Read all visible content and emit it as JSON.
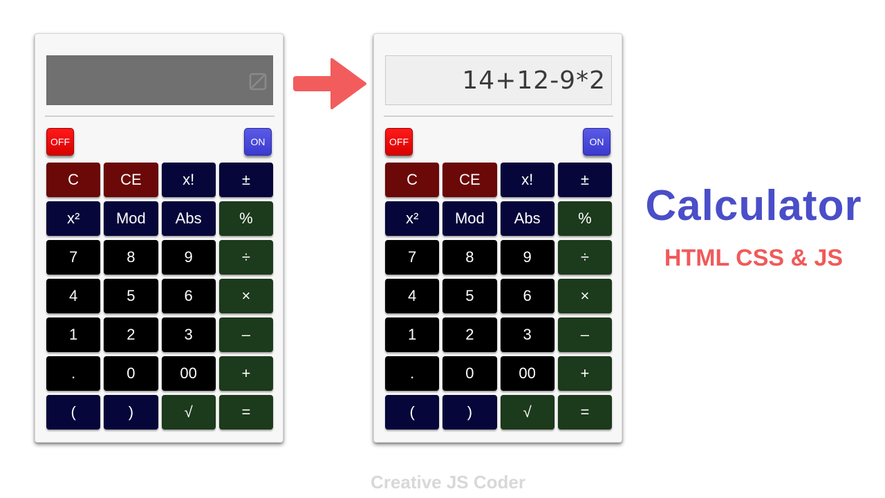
{
  "left_calculator": {
    "screen_state": "off",
    "display_icon": "screen-off-icon",
    "off_label": "OFF",
    "on_label": "ON",
    "keys": [
      {
        "label": "C",
        "color": "red"
      },
      {
        "label": "CE",
        "color": "red"
      },
      {
        "label": "x!",
        "color": "navy"
      },
      {
        "label": "±",
        "color": "navy"
      },
      {
        "label": "x²",
        "color": "navy"
      },
      {
        "label": "Mod",
        "color": "navy"
      },
      {
        "label": "Abs",
        "color": "navy"
      },
      {
        "label": "%",
        "color": "green"
      },
      {
        "label": "7",
        "color": "black"
      },
      {
        "label": "8",
        "color": "black"
      },
      {
        "label": "9",
        "color": "black"
      },
      {
        "label": "÷",
        "color": "green"
      },
      {
        "label": "4",
        "color": "black"
      },
      {
        "label": "5",
        "color": "black"
      },
      {
        "label": "6",
        "color": "black"
      },
      {
        "label": "×",
        "color": "green"
      },
      {
        "label": "1",
        "color": "black"
      },
      {
        "label": "2",
        "color": "black"
      },
      {
        "label": "3",
        "color": "black"
      },
      {
        "label": "–",
        "color": "green"
      },
      {
        "label": ".",
        "color": "black"
      },
      {
        "label": "0",
        "color": "black"
      },
      {
        "label": "00",
        "color": "black"
      },
      {
        "label": "+",
        "color": "green"
      },
      {
        "label": "(",
        "color": "navy"
      },
      {
        "label": ")",
        "color": "navy"
      },
      {
        "label": "√",
        "color": "green"
      },
      {
        "label": "=",
        "color": "green"
      }
    ]
  },
  "right_calculator": {
    "screen_state": "on",
    "display_value": "14+12-9*2",
    "off_label": "OFF",
    "on_label": "ON",
    "keys": [
      {
        "label": "C",
        "color": "red"
      },
      {
        "label": "CE",
        "color": "red"
      },
      {
        "label": "x!",
        "color": "navy"
      },
      {
        "label": "±",
        "color": "navy"
      },
      {
        "label": "x²",
        "color": "navy"
      },
      {
        "label": "Mod",
        "color": "navy"
      },
      {
        "label": "Abs",
        "color": "navy"
      },
      {
        "label": "%",
        "color": "green"
      },
      {
        "label": "7",
        "color": "black"
      },
      {
        "label": "8",
        "color": "black"
      },
      {
        "label": "9",
        "color": "black"
      },
      {
        "label": "÷",
        "color": "green"
      },
      {
        "label": "4",
        "color": "black"
      },
      {
        "label": "5",
        "color": "black"
      },
      {
        "label": "6",
        "color": "black"
      },
      {
        "label": "×",
        "color": "green"
      },
      {
        "label": "1",
        "color": "black"
      },
      {
        "label": "2",
        "color": "black"
      },
      {
        "label": "3",
        "color": "black"
      },
      {
        "label": "–",
        "color": "green"
      },
      {
        "label": ".",
        "color": "black"
      },
      {
        "label": "0",
        "color": "black"
      },
      {
        "label": "00",
        "color": "black"
      },
      {
        "label": "+",
        "color": "green"
      },
      {
        "label": "(",
        "color": "navy"
      },
      {
        "label": ")",
        "color": "navy"
      },
      {
        "label": "√",
        "color": "green"
      },
      {
        "label": "=",
        "color": "green"
      }
    ]
  },
  "arrow_icon": "arrow-right-icon",
  "title": "Calculator",
  "subtitle": "HTML CSS & JS",
  "footer": "Creative JS Coder",
  "colors": {
    "red_key": "#6b0808",
    "navy_key": "#06063a",
    "black_key": "#000000",
    "green_key": "#1c3a1c",
    "title": "#4a4ec8",
    "subtitle": "#f05a5a",
    "arrow": "#f25c5c"
  }
}
